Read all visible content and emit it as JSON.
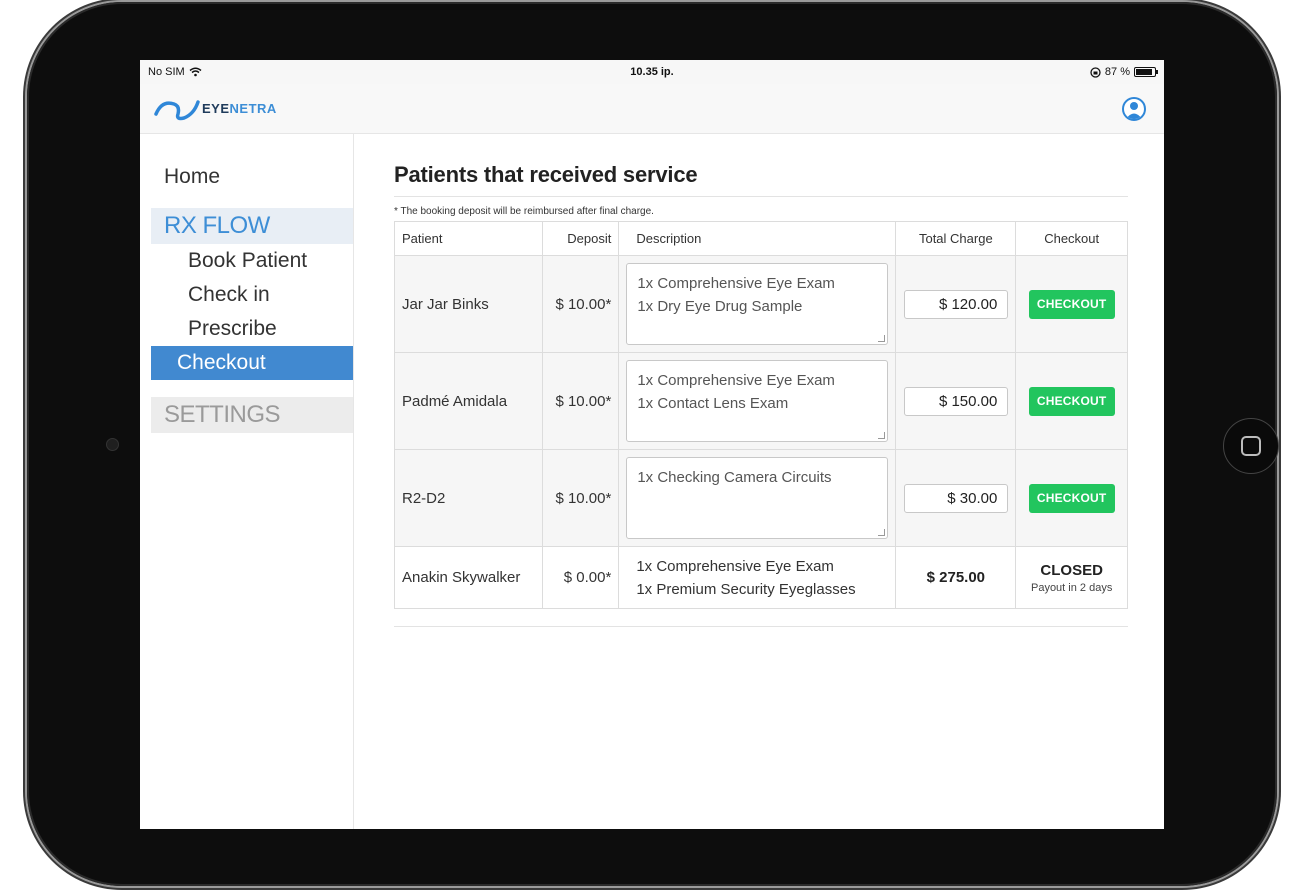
{
  "status_bar": {
    "carrier": "No SIM",
    "time": "10.35 ip.",
    "battery_text": "87 %",
    "battery_level": 0.87
  },
  "nav": {
    "logo_main": "EYE",
    "logo_accent": "NETRA"
  },
  "sidebar": {
    "home": "Home",
    "rx_flow": "RX FLOW",
    "items": [
      {
        "label": "Book Patient"
      },
      {
        "label": "Check in"
      },
      {
        "label": "Prescribe"
      },
      {
        "label": "Checkout"
      }
    ],
    "settings": "SETTINGS"
  },
  "main": {
    "title": "Patients that received service",
    "note": "* The booking deposit will be reimbursed after final charge.",
    "columns": [
      "Patient",
      "Deposit",
      "Description",
      "Total Charge",
      "Checkout"
    ],
    "rows": [
      {
        "patient": "Jar Jar Binks",
        "deposit": "$ 10.00*",
        "desc1": "1x Comprehensive Eye Exam",
        "desc2": "1x Dry Eye Drug Sample",
        "total": "$ 120.00",
        "action": "CHECKOUT"
      },
      {
        "patient": "Padmé Amidala",
        "deposit": "$ 10.00*",
        "desc1": "1x Comprehensive Eye Exam",
        "desc2": "1x Contact Lens Exam",
        "total": "$ 150.00",
        "action": "CHECKOUT"
      },
      {
        "patient": "R2-D2",
        "deposit": "$ 10.00*",
        "desc1": "1x Checking Camera Circuits",
        "desc2": "",
        "total": "$ 30.00",
        "action": "CHECKOUT"
      },
      {
        "patient": "Anakin Skywalker",
        "deposit": "$ 0.00*",
        "desc1": "1x Comprehensive Eye Exam",
        "desc2": "1x Premium Security Eyeglasses",
        "total": "$ 275.00",
        "status": "CLOSED",
        "payout": "Payout in 2 days"
      }
    ]
  },
  "colors": {
    "accent": "#4189d0",
    "success": "#22c55e"
  }
}
